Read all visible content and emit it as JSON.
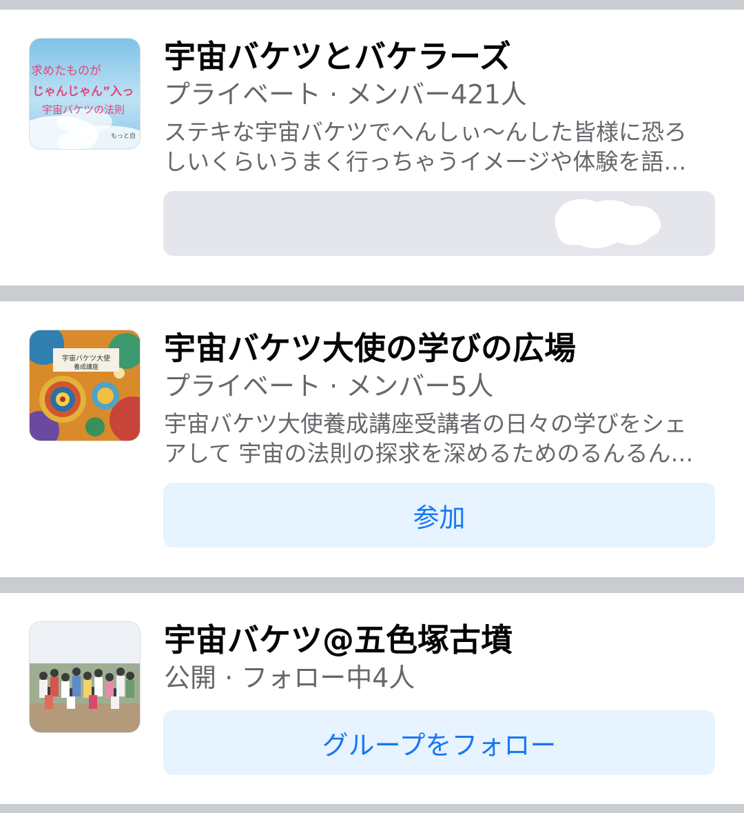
{
  "groups": [
    {
      "title": "宇宙バケツとバケラーズ",
      "meta": "プライベート · メンバー421人",
      "description_lines": [
        "ステキな宇宙バケツでへんしぃ〜んした皆様に恐ろ",
        "しいくらいうまく行っちゃうイメージや体験を語…"
      ],
      "thumbnail_text": [
        "求めたものが",
        "じゃんじゃん”入っ",
        "宇宙バケツの法則",
        "もっと自"
      ],
      "button_label": ""
    },
    {
      "title": "宇宙バケツ大使の学びの広場",
      "meta": "プライベート · メンバー5人",
      "description_lines": [
        "宇宙バケツ大使養成講座受講者の日々の学びをシェ",
        "アして 宇宙の法則の探求を深めるためのるんるん…"
      ],
      "thumbnail_text": [
        "宇宙バケツ大使",
        "養成講座"
      ],
      "button_label": "参加"
    },
    {
      "title": "宇宙バケツ@五色塚古墳",
      "meta": "公開 · フォロー中4人",
      "button_label": "グループをフォロー"
    }
  ],
  "colors": {
    "primary_blue": "#1877f2",
    "light_blue_button": "#e7f3ff",
    "gray_button": "#e4e6eb",
    "secondary_text": "#65676b",
    "separator": "#c9ccd1"
  }
}
